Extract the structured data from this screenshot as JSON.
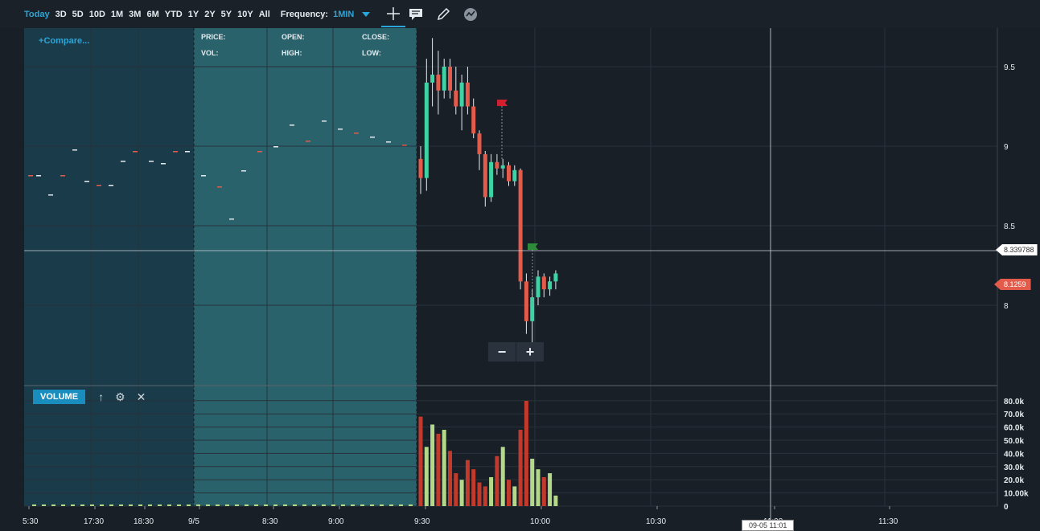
{
  "toolbar": {
    "ranges": [
      "Today",
      "3D",
      "5D",
      "10D",
      "1M",
      "3M",
      "6M",
      "YTD",
      "1Y",
      "2Y",
      "5Y",
      "10Y",
      "All"
    ],
    "active_range": "Today",
    "frequency_label": "Frequency:",
    "frequency_value": "1MIN"
  },
  "compare_label": "Compare...",
  "info": {
    "price": "PRICE:",
    "open": "OPEN:",
    "close": "CLOSE:",
    "vol": "VOL:",
    "high": "HIGH:",
    "low": "LOW:"
  },
  "volume_label": "VOLUME",
  "price_axis_ticks": [
    "9.5",
    "9",
    "8.5",
    "8"
  ],
  "volume_axis_ticks": [
    "80.0k",
    "70.0k",
    "60.0k",
    "50.0k",
    "40.0k",
    "30.0k",
    "20.0k",
    "10.00k",
    "0"
  ],
  "time_axis_ticks": [
    "5:30",
    "17:30",
    "18:30",
    "9/5",
    "8:30",
    "9:00",
    "9:30",
    "10:00",
    "10:30",
    "11:00",
    "11:30"
  ],
  "crosshair_price": "8.339788",
  "last_price": "8.1259",
  "crosshair_time": "09-05 11:01",
  "colors": {
    "up": "#3dd3a5",
    "down": "#e35b4a",
    "vol_up": "#b3d88a",
    "vol_down": "#c23a2c",
    "accent": "#2aa6d8"
  },
  "chart_data": {
    "type": "candlestick",
    "candles": [
      {
        "o": 8.92,
        "h": 9.0,
        "l": 8.7,
        "c": 8.8
      },
      {
        "o": 8.8,
        "h": 9.55,
        "l": 8.72,
        "c": 9.4
      },
      {
        "o": 9.4,
        "h": 9.68,
        "l": 9.25,
        "c": 9.45
      },
      {
        "o": 9.45,
        "h": 9.6,
        "l": 9.2,
        "c": 9.35
      },
      {
        "o": 9.35,
        "h": 9.55,
        "l": 9.3,
        "c": 9.5
      },
      {
        "o": 9.5,
        "h": 9.55,
        "l": 9.3,
        "c": 9.35
      },
      {
        "o": 9.35,
        "h": 9.5,
        "l": 9.2,
        "c": 9.25
      },
      {
        "o": 9.25,
        "h": 9.45,
        "l": 9.1,
        "c": 9.4
      },
      {
        "o": 9.4,
        "h": 9.5,
        "l": 9.2,
        "c": 9.25
      },
      {
        "o": 9.25,
        "h": 9.3,
        "l": 9.05,
        "c": 9.08
      },
      {
        "o": 9.08,
        "h": 9.1,
        "l": 8.85,
        "c": 8.95
      },
      {
        "o": 8.95,
        "h": 8.97,
        "l": 8.62,
        "c": 8.68
      },
      {
        "o": 8.68,
        "h": 8.95,
        "l": 8.65,
        "c": 8.9
      },
      {
        "o": 8.9,
        "h": 8.95,
        "l": 8.82,
        "c": 8.86
      },
      {
        "o": 8.86,
        "h": 8.92,
        "l": 8.8,
        "c": 8.88
      },
      {
        "o": 8.88,
        "h": 8.9,
        "l": 8.75,
        "c": 8.78
      },
      {
        "o": 8.78,
        "h": 8.88,
        "l": 8.75,
        "c": 8.85
      },
      {
        "o": 8.85,
        "h": 8.86,
        "l": 8.1,
        "c": 8.15
      },
      {
        "o": 8.15,
        "h": 8.2,
        "l": 7.82,
        "c": 7.9
      },
      {
        "o": 7.9,
        "h": 8.1,
        "l": 7.7,
        "c": 8.05
      },
      {
        "o": 8.05,
        "h": 8.22,
        "l": 8.0,
        "c": 8.18
      },
      {
        "o": 8.18,
        "h": 8.2,
        "l": 8.05,
        "c": 8.1
      },
      {
        "o": 8.1,
        "h": 8.18,
        "l": 8.06,
        "c": 8.15
      },
      {
        "o": 8.15,
        "h": 8.22,
        "l": 8.1,
        "c": 8.2
      }
    ],
    "volumes": [
      68000,
      45000,
      62000,
      55000,
      58000,
      42000,
      25000,
      20000,
      35000,
      28000,
      18000,
      15000,
      22000,
      38000,
      45000,
      20000,
      15000,
      58000,
      80000,
      36000,
      28000,
      22000,
      25000,
      8000
    ]
  }
}
